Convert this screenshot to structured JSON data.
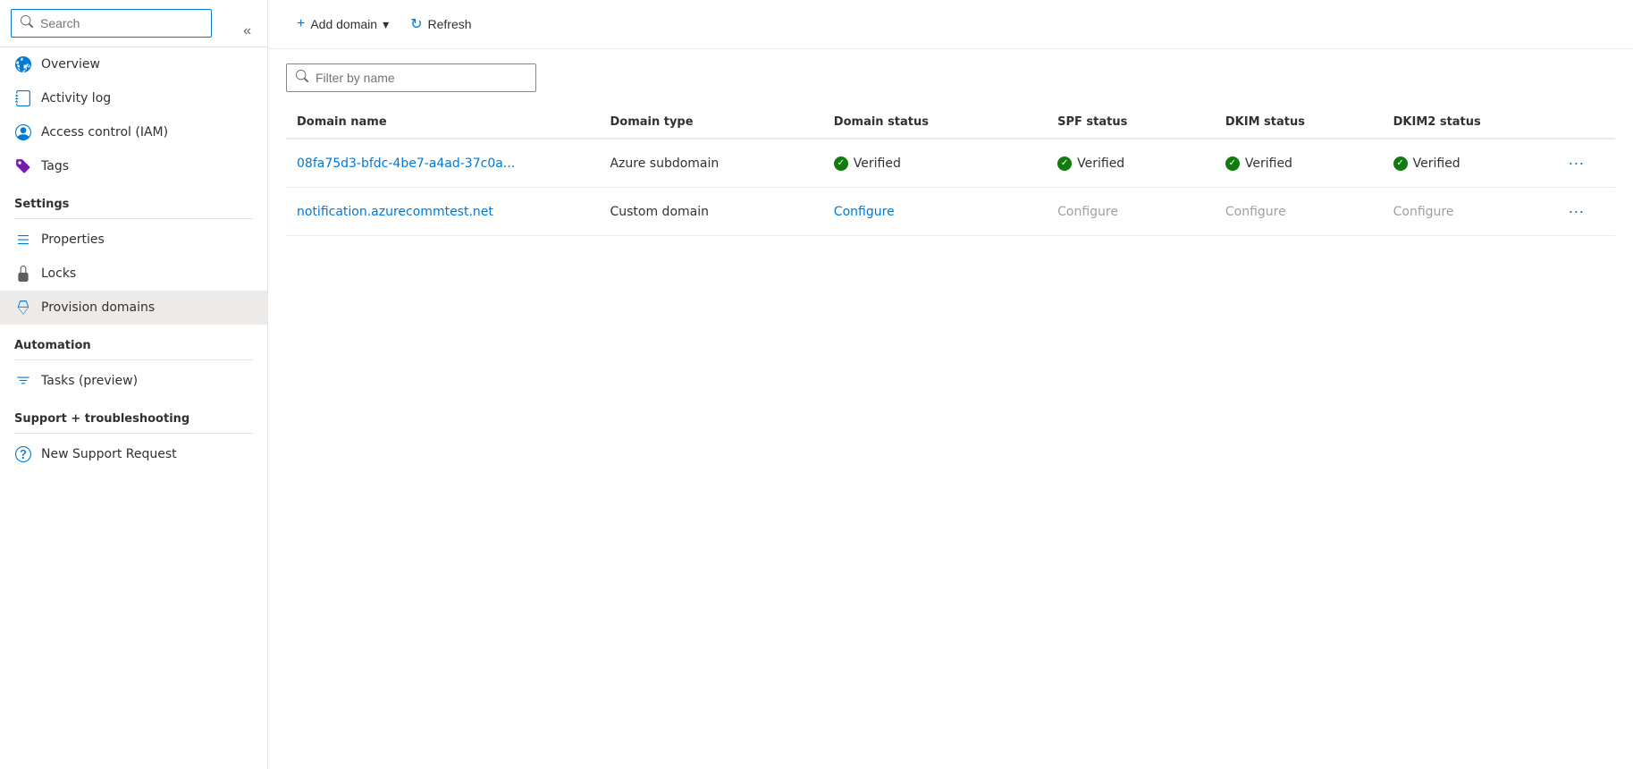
{
  "sidebar": {
    "search": {
      "placeholder": "Search",
      "value": ""
    },
    "collapse_label": "«",
    "nav_items": [
      {
        "id": "overview",
        "label": "Overview",
        "icon": "globe-icon",
        "active": false
      },
      {
        "id": "activity-log",
        "label": "Activity log",
        "icon": "notebook-icon",
        "active": false
      }
    ],
    "access_control": {
      "label": "Access control (IAM)",
      "icon": "person-icon"
    },
    "tags": {
      "label": "Tags",
      "icon": "tag-icon"
    },
    "settings_section": {
      "label": "Settings",
      "items": [
        {
          "id": "properties",
          "label": "Properties",
          "icon": "bars-icon",
          "active": false
        },
        {
          "id": "locks",
          "label": "Locks",
          "icon": "lock-icon",
          "active": false
        },
        {
          "id": "provision-domains",
          "label": "Provision domains",
          "icon": "diamond-icon",
          "active": true
        }
      ]
    },
    "automation_section": {
      "label": "Automation",
      "items": [
        {
          "id": "tasks",
          "label": "Tasks (preview)",
          "icon": "tasks-icon",
          "active": false
        }
      ]
    },
    "support_section": {
      "label": "Support + troubleshooting",
      "items": [
        {
          "id": "new-support",
          "label": "New Support Request",
          "icon": "support-icon",
          "active": false
        }
      ]
    }
  },
  "toolbar": {
    "add_domain_label": "Add domain",
    "add_domain_icon": "+",
    "dropdown_icon": "▾",
    "refresh_label": "Refresh",
    "refresh_icon": "↻"
  },
  "filter": {
    "placeholder": "Filter by name"
  },
  "table": {
    "columns": [
      {
        "id": "domain-name",
        "label": "Domain name"
      },
      {
        "id": "domain-type",
        "label": "Domain type"
      },
      {
        "id": "domain-status",
        "label": "Domain status"
      },
      {
        "id": "spf-status",
        "label": "SPF status"
      },
      {
        "id": "dkim-status",
        "label": "DKIM status"
      },
      {
        "id": "dkim2-status",
        "label": "DKIM2 status"
      }
    ],
    "rows": [
      {
        "id": "row-1",
        "domain_name": "08fa75d3-bfdc-4be7-a4ad-37c0a...",
        "domain_name_full": "08fa75d3-bfdc-4be7-a4ad-37c0a...",
        "domain_type": "Azure subdomain",
        "domain_status": "Verified",
        "domain_status_type": "verified",
        "spf_status": "Verified",
        "spf_status_type": "verified",
        "dkim_status": "Verified",
        "dkim_status_type": "verified",
        "dkim2_status": "Verified",
        "dkim2_status_type": "verified"
      },
      {
        "id": "row-2",
        "domain_name": "notification.azurecommtest.net",
        "domain_name_full": "notification.azurecommtest.net",
        "domain_type": "Custom domain",
        "domain_status": "Configure",
        "domain_status_type": "configure-link",
        "spf_status": "Configure",
        "spf_status_type": "configure-gray",
        "dkim_status": "Configure",
        "dkim_status_type": "configure-gray",
        "dkim2_status": "Configure",
        "dkim2_status_type": "configure-gray"
      }
    ]
  }
}
